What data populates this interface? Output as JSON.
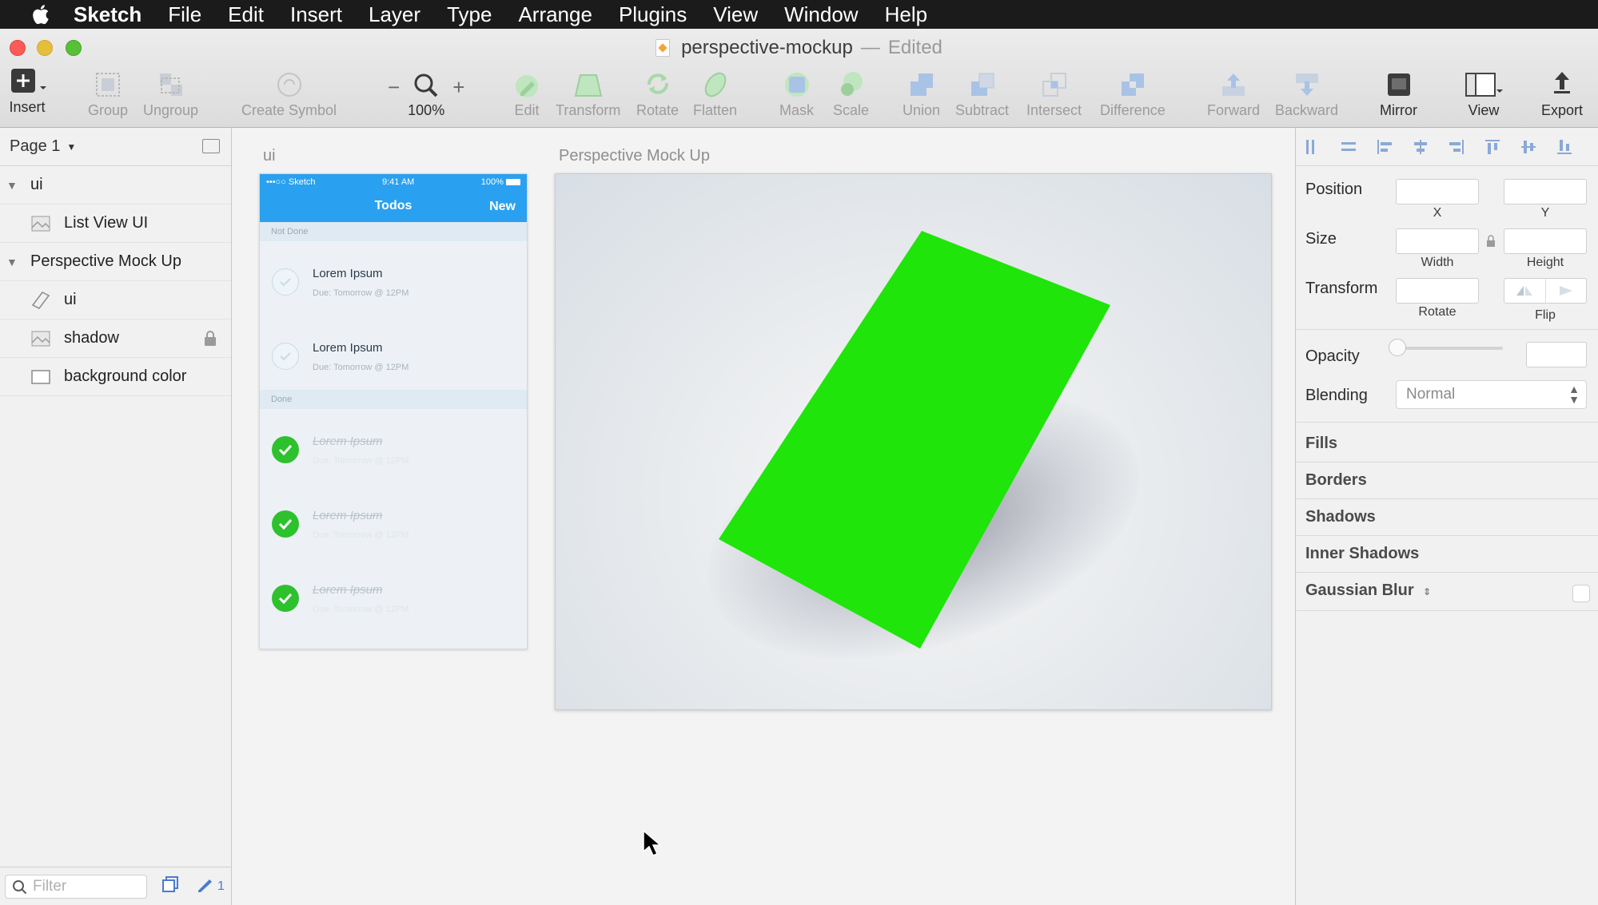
{
  "menubar": {
    "app": "Sketch",
    "items": [
      "File",
      "Edit",
      "Insert",
      "Layer",
      "Type",
      "Arrange",
      "Plugins",
      "View",
      "Window",
      "Help"
    ]
  },
  "window": {
    "title": "perspective-mockup",
    "separator": "—",
    "status": "Edited"
  },
  "toolbar": {
    "insert": "Insert",
    "group": "Group",
    "ungroup": "Ungroup",
    "create_symbol": "Create Symbol",
    "zoom_minus": "−",
    "zoom_plus": "+",
    "zoom_level": "100%",
    "edit": "Edit",
    "transform": "Transform",
    "rotate": "Rotate",
    "flatten": "Flatten",
    "mask": "Mask",
    "scale": "Scale",
    "union": "Union",
    "subtract": "Subtract",
    "intersect": "Intersect",
    "difference": "Difference",
    "forward": "Forward",
    "backward": "Backward",
    "mirror": "Mirror",
    "view": "View",
    "export": "Export"
  },
  "sidebar": {
    "page": "Page 1",
    "layers": {
      "ui_group": "ui",
      "list_view": "List View UI",
      "mockup_group": "Perspective Mock Up",
      "ui_symbol": "ui",
      "shadow": "shadow",
      "background": "background color"
    },
    "filter_placeholder": "Filter",
    "footer_count": "1"
  },
  "canvas": {
    "artboard1_title": "ui",
    "artboard2_title": "Perspective Mock Up",
    "phone": {
      "carrier": "•••○○ Sketch",
      "time": "9:41 AM",
      "battery": "100%",
      "nav_title": "Todos",
      "nav_action": "New",
      "section_not_done": "Not Done",
      "section_done": "Done",
      "todos_open": [
        {
          "title": "Lorem Ipsum",
          "due": "Due: Tomorrow @ 12PM"
        },
        {
          "title": "Lorem Ipsum",
          "due": "Due: Tomorrow @ 12PM"
        }
      ],
      "todos_done": [
        {
          "title": "Lorem Ipsum",
          "due": "Due: Tomorrow @ 12PM"
        },
        {
          "title": "Lorem Ipsum",
          "due": "Due: Tomorrow @ 12PM"
        },
        {
          "title": "Lorem Ipsum",
          "due": "Due: Tomorrow @ 12PM"
        }
      ],
      "header_color": "#2aa0f0",
      "check_color": "#2ec12e"
    },
    "screen_color": "#1fe50a"
  },
  "inspector": {
    "position": "Position",
    "x": "X",
    "y": "Y",
    "size": "Size",
    "width": "Width",
    "height": "Height",
    "transform": "Transform",
    "rotate": "Rotate",
    "flip": "Flip",
    "opacity": "Opacity",
    "blending": "Blending",
    "blending_value": "Normal",
    "fills": "Fills",
    "borders": "Borders",
    "shadows": "Shadows",
    "inner_shadows": "Inner Shadows",
    "gaussian_blur": "Gaussian Blur"
  }
}
